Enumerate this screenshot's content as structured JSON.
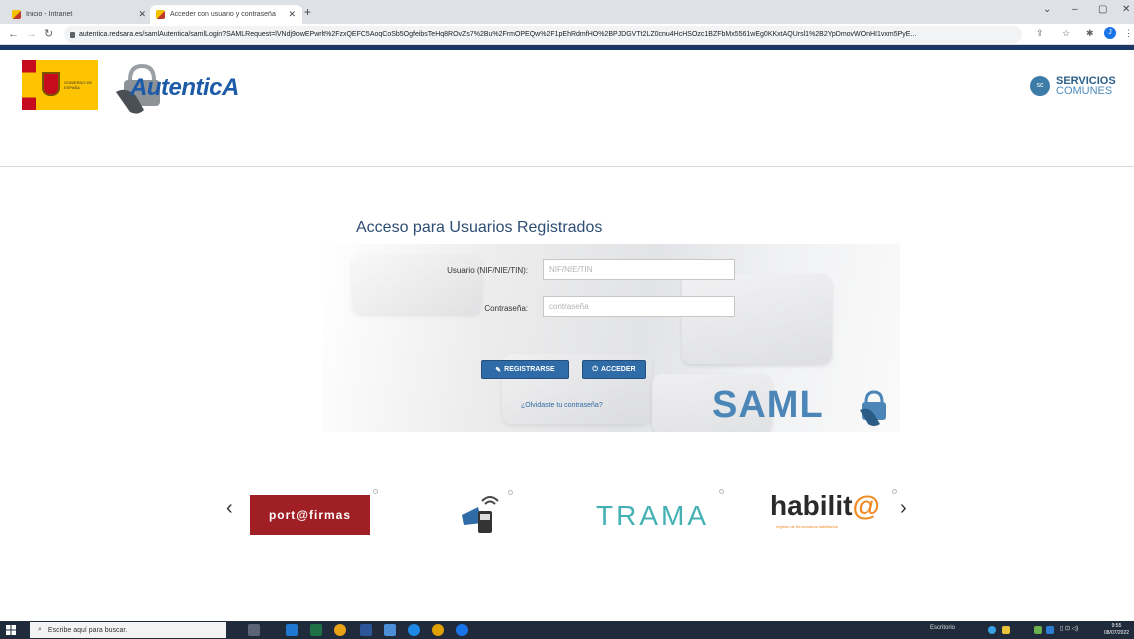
{
  "browser": {
    "tabs": [
      {
        "title": "Inicio - Intranet",
        "active": false
      },
      {
        "title": "Acceder con usuario y contraseña",
        "active": true
      }
    ],
    "new_tab_icon": "plus-icon",
    "url": "autentica.redsara.es/samlAutentica/samlLogin?SAMLRequest=lVNdj9owEPwrlt%2FzxQEFC5AoqCoSb5OgfeibsTeHq8ROvZs7%2Bu%2FrmOPEQw%2F1pEhRdmfHO%2BPJDGVTt2LZ0cnu4HcHSOzc1BZFbMx5561wEg0KKxtAQUrsl1%2B2YpDmovWOnHI1vxm5PyE..."
  },
  "header": {
    "gob_text": "GOBIERNO DE ESPAÑA",
    "brand": "AutenticA",
    "servicios_line1": "SERVICIOS",
    "servicios_line2": "COMUNES",
    "servicios_icon": "sc"
  },
  "login": {
    "title": "Acceso para Usuarios Registrados",
    "user_label": "Usuario (NIF/NIE/TIN):",
    "user_placeholder": "NIF/NIE/TIN",
    "user_value": "",
    "password_label": "Contraseña:",
    "password_placeholder": "contraseña",
    "password_value": "",
    "register_label": "REGISTRARSE",
    "access_label": "ACCEDER",
    "forgot_label": "¿Olvidaste tu contraseña?",
    "saml_text": "SAML"
  },
  "carousel": {
    "portafirmas": "port@firmas",
    "trama": "TRAMA",
    "habilita_main": "habilit",
    "habilita_at": "@",
    "habilita_sub": "registro de funcionarios habilitados"
  },
  "taskbar": {
    "search_placeholder": "Escribe aquí para buscar.",
    "tray_label": "Escritorio",
    "time": "9:55",
    "date": "08/07/2022"
  }
}
